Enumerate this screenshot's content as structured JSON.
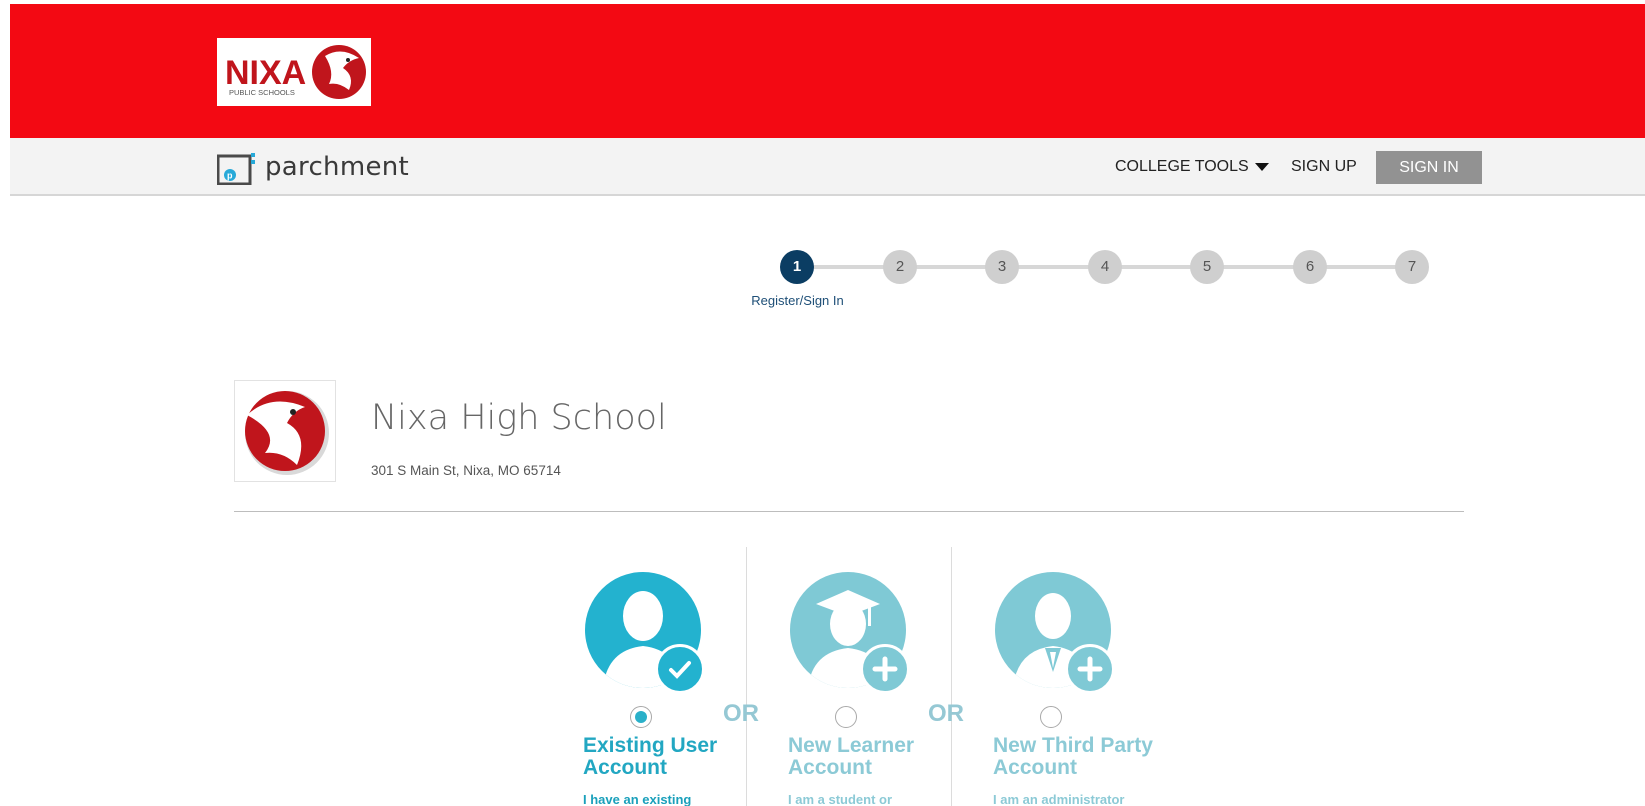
{
  "district": {
    "logo_text": "NIXA",
    "logo_subtext": "PUBLIC SCHOOLS"
  },
  "header": {
    "brand": "parchment",
    "nav": {
      "college_tools": "COLLEGE TOOLS",
      "sign_up": "SIGN UP",
      "sign_in": "SIGN IN"
    }
  },
  "stepper": {
    "steps": [
      "1",
      "2",
      "3",
      "4",
      "5",
      "6",
      "7"
    ],
    "active_index": 0,
    "active_caption": "Register/Sign In"
  },
  "school": {
    "name": "Nixa High School",
    "address": "301 S Main St, Nixa, MO 65714"
  },
  "accounts": [
    {
      "title": "Existing User Account",
      "desc": "I have an existing",
      "selected": true,
      "icon": "user-check-icon"
    },
    {
      "title": "New Learner Account",
      "desc": "I am a student or",
      "selected": false,
      "icon": "graduate-plus-icon"
    },
    {
      "title": "New Third Party Account",
      "desc": "I am an administrator",
      "selected": false,
      "icon": "administrator-plus-icon"
    }
  ],
  "or_label": "OR",
  "colors": {
    "brand_red": "#f30913",
    "nav_bg": "#f3f3f3",
    "step_active": "#0b3d63",
    "accent_teal": "#2ab0c9",
    "muted_teal": "#7fc9d5"
  }
}
